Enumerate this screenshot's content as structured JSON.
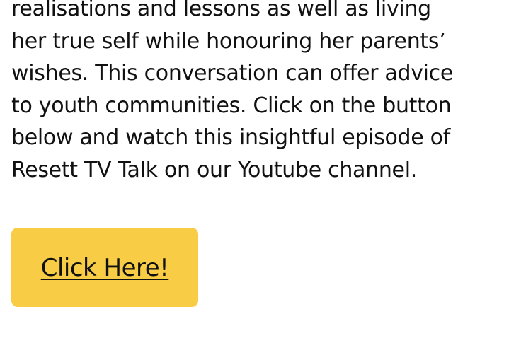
{
  "article": {
    "lines": [
      "realisations and lessons as well as living",
      "her true self while honouring her parents’",
      "wishes. This conversation can offer advice",
      "to youth communities. Click on the button",
      "below and watch this insightful episode of",
      "Resett TV Talk on our Youtube channel."
    ]
  },
  "cta": {
    "label": "Click Here!",
    "background_color": "#f8cc45"
  }
}
